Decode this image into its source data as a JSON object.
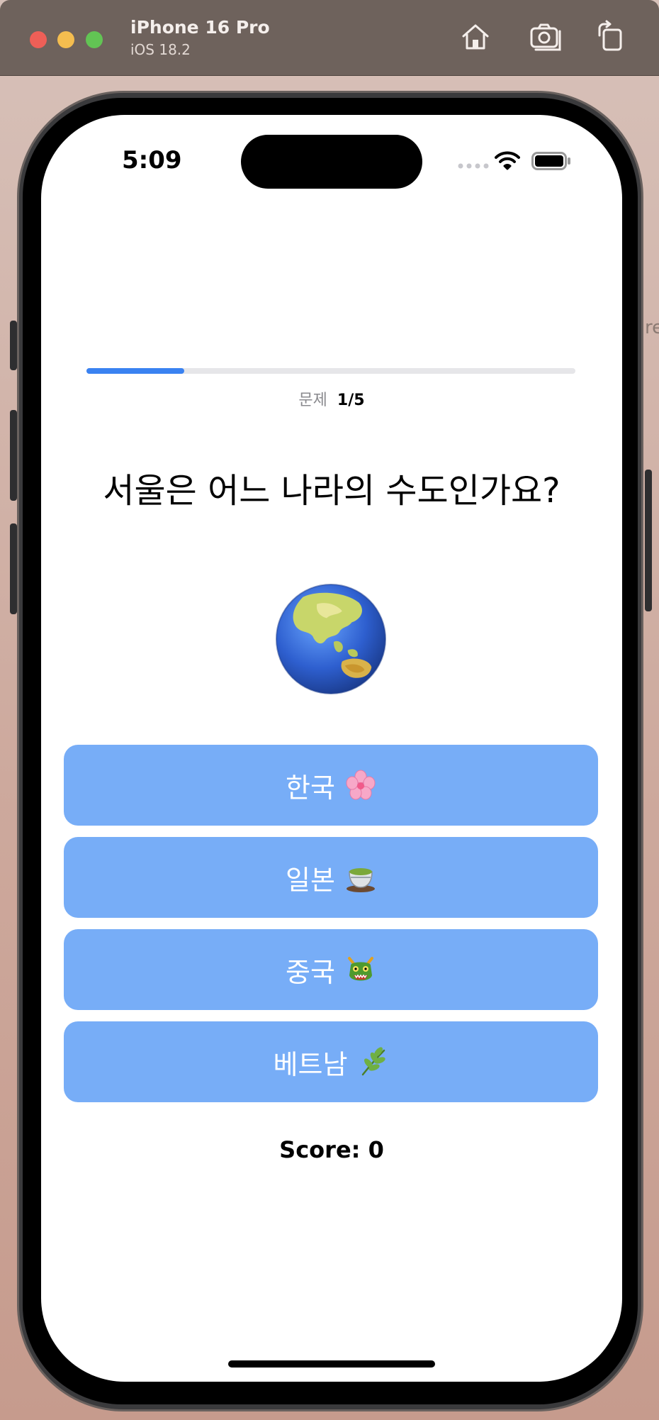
{
  "simulator": {
    "device_name": "iPhone 16 Pro",
    "os_version": "iOS 18.2",
    "behind_window_text": "re",
    "toolbar": {
      "home_icon": "home-icon",
      "screenshot_icon": "camera-icon",
      "rotate_icon": "rotate-icon"
    }
  },
  "status_bar": {
    "time": "5:09"
  },
  "quiz": {
    "progress_fraction": 0.2,
    "progress_label": "문제",
    "progress_value": "1/5",
    "question": "서울은 어느 나라의 수도인가요?",
    "question_icon": "globe-asia-icon",
    "answers": [
      {
        "label": "한국",
        "icon": "cherry-blossom-icon"
      },
      {
        "label": "일본",
        "icon": "green-tea-icon"
      },
      {
        "label": "중국",
        "icon": "dragon-face-icon"
      },
      {
        "label": "베트남",
        "icon": "herb-icon"
      }
    ],
    "score_label": "Score: 0"
  },
  "colors": {
    "accent": "#3a82f1",
    "answer_button": "#77adf7",
    "track": "#e6e6e9"
  }
}
